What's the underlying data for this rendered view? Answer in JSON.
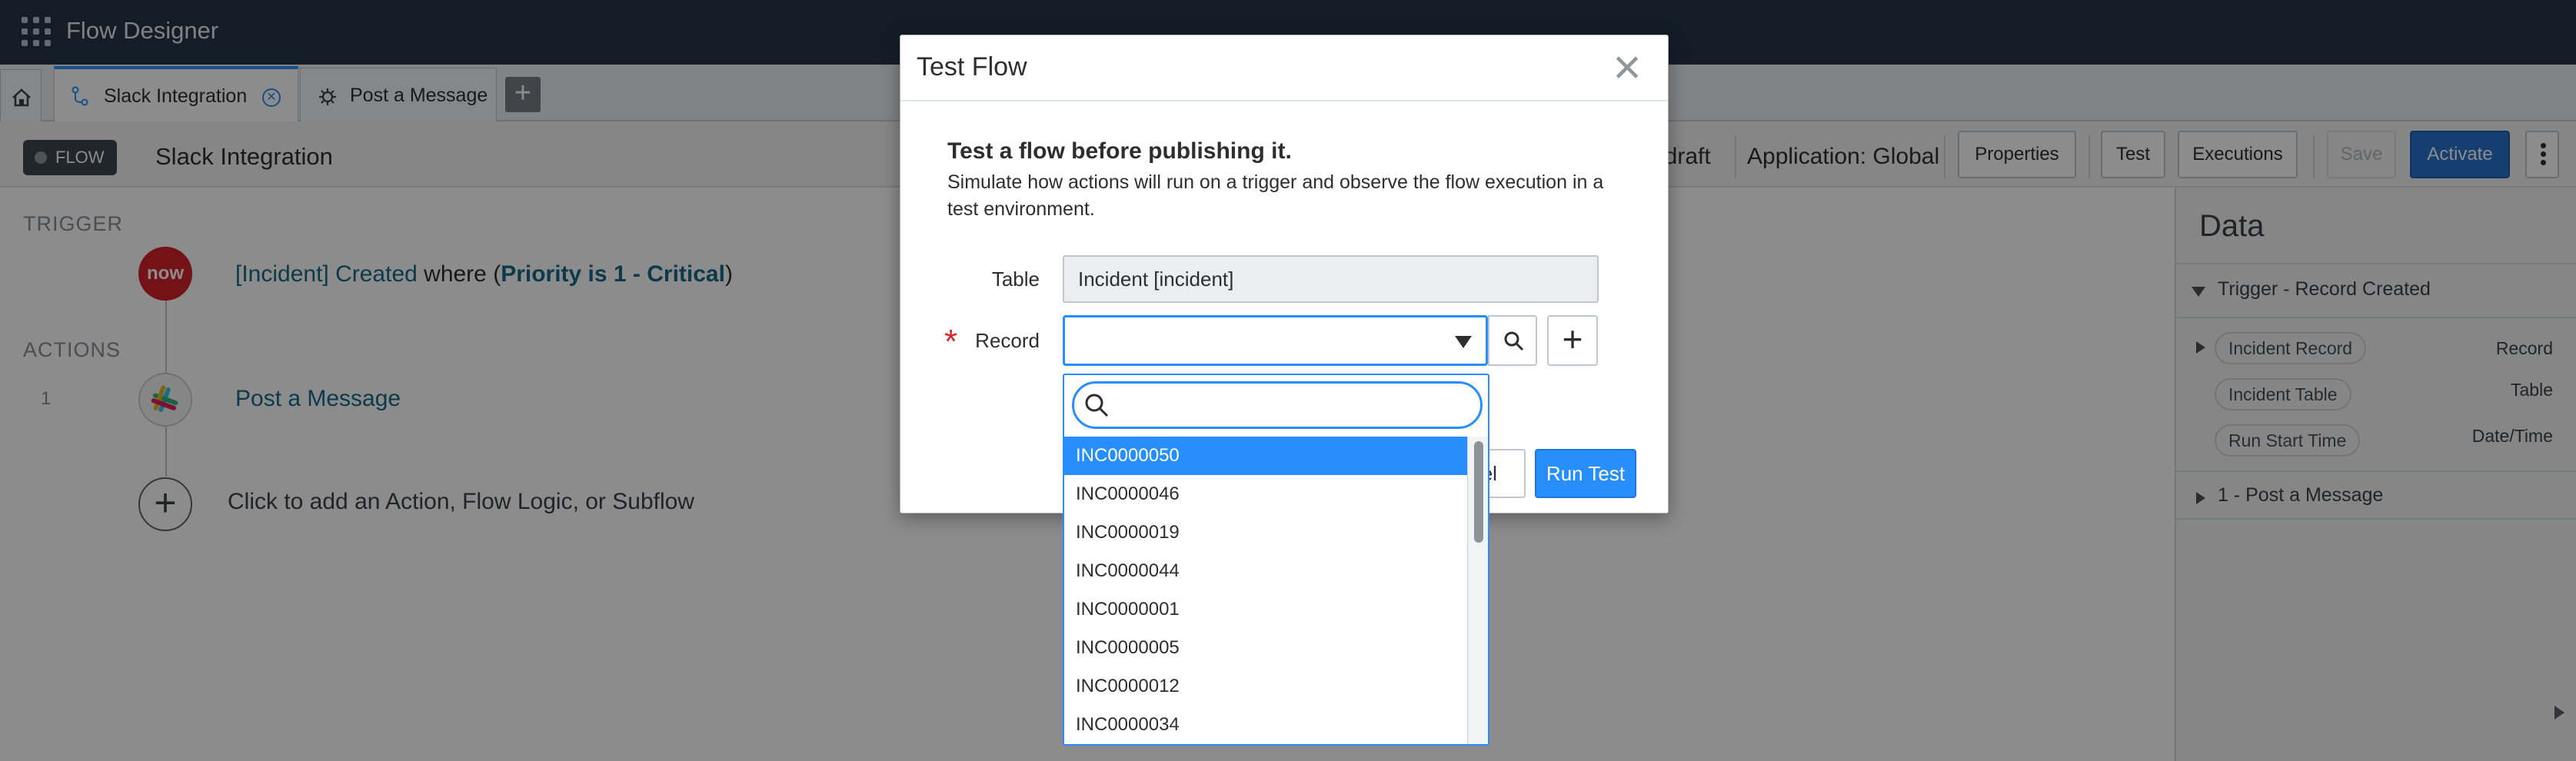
{
  "app": {
    "title": "Flow Designer"
  },
  "tabs": [
    {
      "label": "Slack Integration",
      "active": true
    },
    {
      "label": "Post a Message",
      "active": false
    }
  ],
  "flow": {
    "badge": "FLOW",
    "name": "Slack Integration",
    "status": ": draft",
    "application": "Application: Global"
  },
  "header_buttons": {
    "properties": "Properties",
    "test": "Test",
    "executions": "Executions",
    "save": "Save",
    "activate": "Activate"
  },
  "canvas": {
    "trigger_label": "TRIGGER",
    "trigger": {
      "icon_text": "now",
      "part1": "[Incident] Created",
      "part2": " where (",
      "part3": "Priority is 1 - Critical",
      "part4": ")"
    },
    "actions_label": "ACTIONS",
    "action": {
      "number": "1",
      "name": "Post a Message"
    },
    "add_label": "Click to add an Action, Flow Logic, or Subflow"
  },
  "data_panel": {
    "title": "Data",
    "trigger_section": "Trigger - Record Created",
    "pills": [
      {
        "label": "Incident Record",
        "type": "Record"
      },
      {
        "label": "Incident Table",
        "type": "Table"
      },
      {
        "label": "Run Start Time",
        "type": "Date/Time"
      }
    ],
    "action_section": "1 - Post a Message"
  },
  "modal": {
    "title": "Test Flow",
    "heading": "Test a flow before publishing it.",
    "description": "Simulate how actions will run on a trigger and observe the flow execution in a test environment.",
    "table_label": "Table",
    "table_value": "Incident [incident]",
    "record_label": "Record",
    "cancel": "Cancel",
    "run_test": "Run Test"
  },
  "dropdown": {
    "search_value": "",
    "items": [
      "INC0000050",
      "INC0000046",
      "INC0000019",
      "INC0000044",
      "INC0000001",
      "INC0000005",
      "INC0000012",
      "INC0000034"
    ],
    "selected": "INC0000050"
  },
  "colors": {
    "topbar": "#263647",
    "accent": "#278efc",
    "activate": "#2774cc",
    "now_red": "#d2212b",
    "link": "#186a89"
  }
}
